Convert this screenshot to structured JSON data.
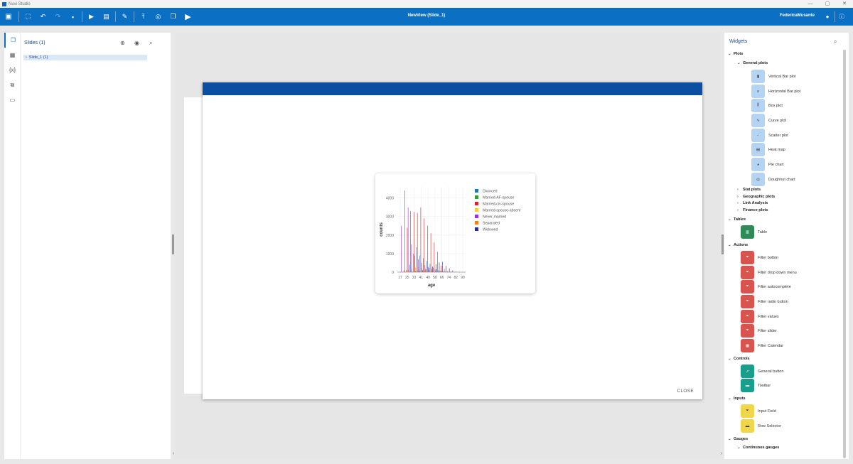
{
  "window": {
    "title": "Nuvi Studio",
    "controls": [
      "—",
      "▢",
      "✕"
    ]
  },
  "toolbar": {
    "view_title": "NewView (Slide_1)",
    "user": "FedericaMusante",
    "icons": [
      "logo-icon",
      "fit-screen-icon",
      "undo-icon",
      "redo-icon",
      "save-icon",
      "present-icon",
      "preview-icon",
      "wrench-icon",
      "upload-icon",
      "target-icon",
      "cube-icon",
      "play-icon",
      "account-icon",
      "info-icon"
    ]
  },
  "slides_panel": {
    "title": "Slides (1)",
    "items": [
      {
        "label": "Slide_1 (1)"
      }
    ]
  },
  "slide": {
    "close_label": "CLOSE",
    "band_color": "#0b4fa3"
  },
  "widgets_panel": {
    "title": "Widgets",
    "sections": {
      "plots": "Plots",
      "general_plots": "General plots",
      "general_items": [
        "Vertical Bar plot",
        "Horizontal Bar plot",
        "Box plot",
        "Curve plot",
        "Scatter plot",
        "Heat map",
        "Pie chart",
        "Doughnut chart"
      ],
      "stat_plots": "Stat plots",
      "geographic_plots": "Geographic plots",
      "link_analysis": "Link Analysis",
      "finance_plots": "Finance plots",
      "tables": "Tables",
      "table_items": [
        "Table"
      ],
      "actions": "Actions",
      "action_items": [
        "Filter button",
        "Filter drop down menu",
        "Filter autocomplete",
        "Filter radio button",
        "Filter values",
        "Filter slider",
        "Filter Calendar"
      ],
      "controls": "Controls",
      "control_items": [
        "General button",
        "Toolbar"
      ],
      "inputs": "Inputs",
      "input_items": [
        "Input Field",
        "Row Selector"
      ],
      "gauges": "Gauges",
      "continuous_gauges": "Continuous gauges"
    }
  },
  "chart_data": {
    "type": "bar",
    "xlabel": "age",
    "ylabel": "counts",
    "x_ticks": [
      "17",
      "25",
      "33",
      "41",
      "49",
      "58",
      "66",
      "74",
      "82",
      "90"
    ],
    "y_ticks": [
      "0",
      "1000",
      "2000",
      "3000",
      "4000"
    ],
    "ylim": [
      0,
      4600
    ],
    "grid": true,
    "legend_position": "right",
    "categories": [
      "17",
      "21",
      "25",
      "29",
      "33",
      "37",
      "41",
      "45",
      "49",
      "53",
      "58",
      "62",
      "66",
      "70",
      "74",
      "78",
      "82",
      "86",
      "90"
    ],
    "series": [
      {
        "name": "Divorced",
        "color": "#1f77b4",
        "values": [
          0,
          20,
          120,
          400,
          1000,
          1350,
          900,
          750,
          600,
          450,
          250,
          150,
          80,
          40,
          10,
          5,
          0,
          0,
          0
        ]
      },
      {
        "name": "Married-AF-spouse",
        "color": "#2ca02c",
        "values": [
          0,
          0,
          2,
          4,
          4,
          3,
          2,
          1,
          1,
          1,
          0,
          0,
          0,
          0,
          0,
          0,
          0,
          0,
          0
        ]
      },
      {
        "name": "Married-civ-spouse",
        "color": "#d62728",
        "values": [
          0,
          100,
          2400,
          3300,
          3250,
          3200,
          3500,
          2900,
          2500,
          2100,
          1600,
          1100,
          350,
          180,
          60,
          40,
          10,
          5,
          0
        ]
      },
      {
        "name": "Married-spouse-absent",
        "color": "#f2d12e",
        "values": [
          0,
          10,
          40,
          70,
          80,
          90,
          80,
          60,
          50,
          40,
          30,
          20,
          10,
          5,
          0,
          0,
          0,
          0,
          0
        ]
      },
      {
        "name": "Never-married",
        "color": "#9b30d9",
        "values": [
          2500,
          4400,
          3500,
          1500,
          900,
          700,
          500,
          380,
          280,
          200,
          150,
          100,
          60,
          30,
          10,
          5,
          0,
          0,
          0
        ]
      },
      {
        "name": "Separated",
        "color": "#ff7f0e",
        "values": [
          0,
          20,
          120,
          200,
          250,
          260,
          220,
          160,
          120,
          90,
          60,
          30,
          10,
          5,
          0,
          0,
          0,
          0,
          0
        ]
      },
      {
        "name": "Widowed",
        "color": "#2b2d8c",
        "values": [
          0,
          0,
          5,
          20,
          40,
          70,
          110,
          160,
          220,
          300,
          420,
          520,
          560,
          340,
          200,
          100,
          30,
          10,
          5
        ]
      }
    ]
  }
}
